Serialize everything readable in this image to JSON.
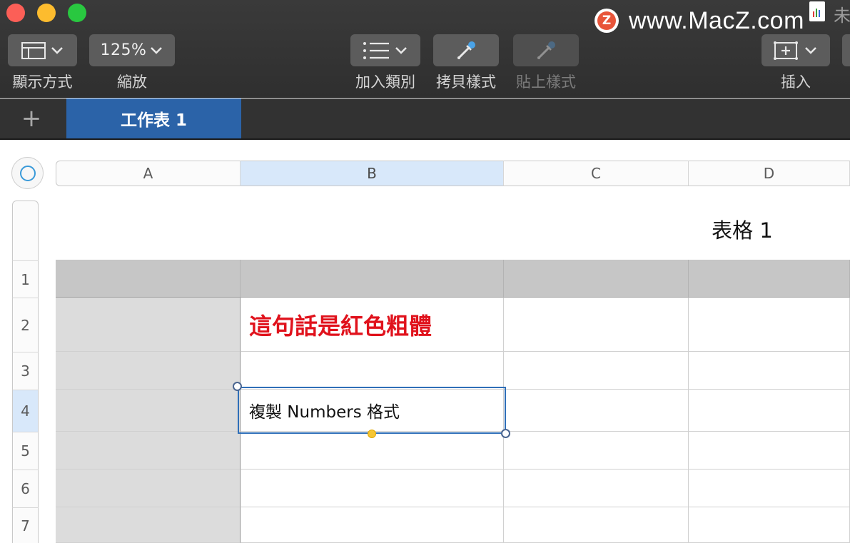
{
  "window": {
    "traffic_lights": [
      "close",
      "minimize",
      "zoom"
    ],
    "corner_text": "未"
  },
  "toolbar": {
    "view": {
      "label": "顯示方式",
      "icon": "sidebar-layout-icon"
    },
    "zoom": {
      "value": "125%",
      "label": "縮放"
    },
    "add_category": {
      "label": "加入類別",
      "icon": "list-icon"
    },
    "copy_style": {
      "label": "拷貝樣式",
      "icon": "eyedropper-icon"
    },
    "paste_style": {
      "label": "貼上樣式",
      "icon": "eyedropper-icon",
      "disabled": true
    },
    "insert": {
      "label": "插入",
      "icon": "insert-box-icon"
    }
  },
  "watermark": {
    "badge": "Z",
    "text": "www.MacZ.com"
  },
  "sheets": {
    "add_label": "+",
    "active": "工作表 1"
  },
  "spreadsheet": {
    "columns": [
      "A",
      "B",
      "C",
      "D"
    ],
    "selected_column": "B",
    "rows": [
      "1",
      "2",
      "3",
      "4",
      "5",
      "6",
      "7"
    ],
    "selected_row": "4",
    "table_title": "表格 1",
    "cells": {
      "B2": "這句話是紅色粗體",
      "B4": "複製 Numbers 格式"
    }
  },
  "colors": {
    "accent": "#2b63a8",
    "selection": "#2f6fb8",
    "red_text": "#e0121c",
    "header_row": "#c6c6c6",
    "header_column": "#dcdcdc"
  }
}
